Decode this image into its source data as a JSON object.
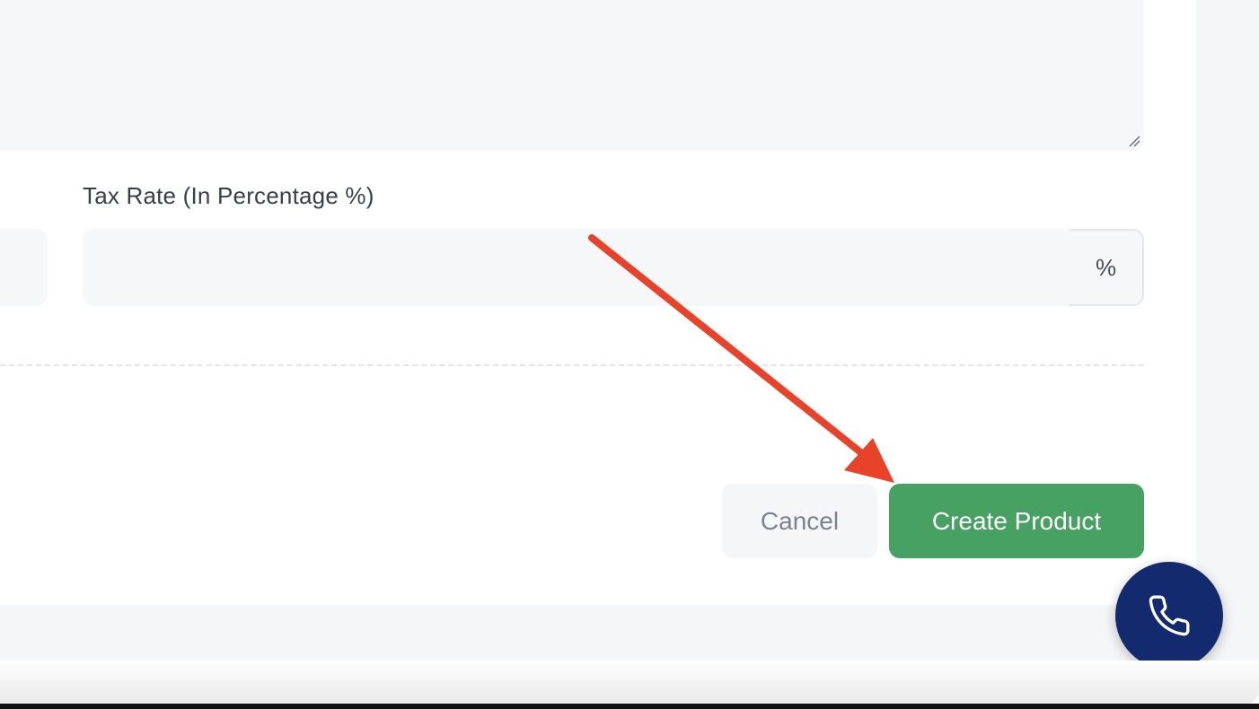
{
  "form": {
    "tax_rate": {
      "label": "Tax Rate (In Percentage %)",
      "value": "",
      "addon": "%"
    }
  },
  "actions": {
    "cancel_label": "Cancel",
    "create_label": "Create Product"
  },
  "floating": {
    "call_icon": "phone-icon"
  },
  "colors": {
    "primary_button": "#47a162",
    "call_button": "#142a6e",
    "annotation_arrow": "#e8432a"
  }
}
